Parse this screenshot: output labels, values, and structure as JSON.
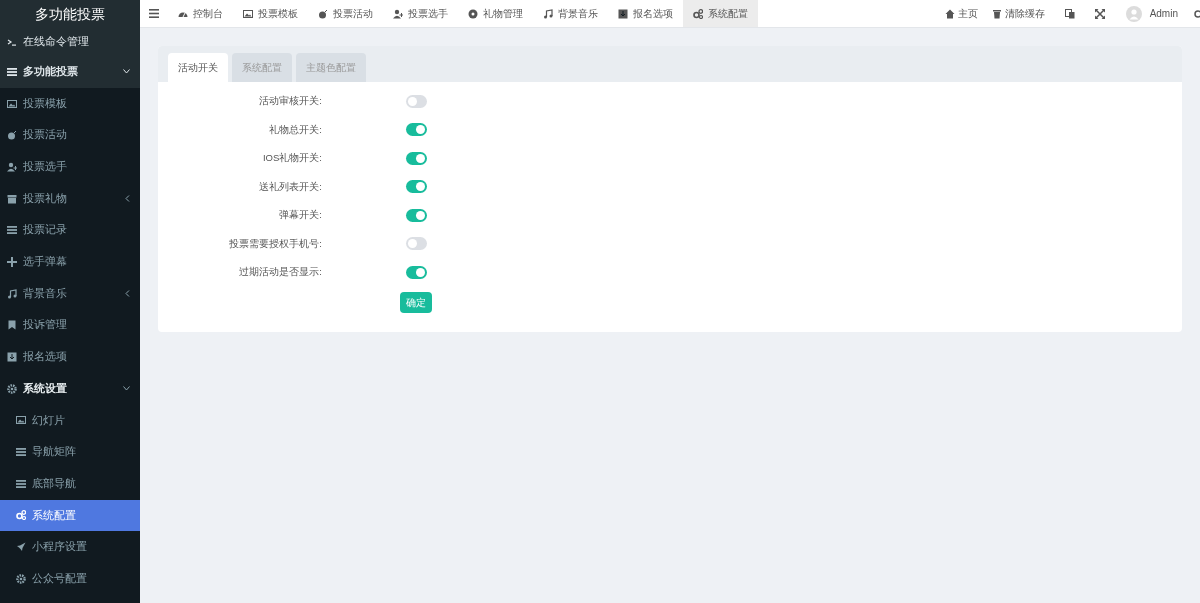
{
  "logo": "多功能投票",
  "sidebar": {
    "items": [
      {
        "label": "在线命令管理",
        "kind": "item",
        "selected": false
      },
      {
        "label": "多功能投票",
        "kind": "group",
        "expanded": true,
        "children": [
          {
            "label": "投票模板",
            "kind": "item",
            "selected": false
          },
          {
            "label": "投票活动",
            "kind": "item",
            "selected": false
          },
          {
            "label": "投票选手",
            "kind": "item",
            "selected": false
          },
          {
            "label": "投票礼物",
            "kind": "group",
            "expanded": false
          },
          {
            "label": "投票记录",
            "kind": "item",
            "selected": false
          },
          {
            "label": "选手弹幕",
            "kind": "item",
            "selected": false
          },
          {
            "label": "背景音乐",
            "kind": "group",
            "expanded": false
          },
          {
            "label": "投诉管理",
            "kind": "item",
            "selected": false
          },
          {
            "label": "报名选项",
            "kind": "item",
            "selected": false
          },
          {
            "label": "系统设置",
            "kind": "group",
            "expanded": true,
            "children": [
              {
                "label": "幻灯片",
                "kind": "item",
                "selected": false
              },
              {
                "label": "导航矩阵",
                "kind": "item",
                "selected": false
              },
              {
                "label": "底部导航",
                "kind": "item",
                "selected": false
              },
              {
                "label": "系统配置",
                "kind": "item",
                "selected": true
              },
              {
                "label": "小程序设置",
                "kind": "item",
                "selected": false
              },
              {
                "label": "公众号配置",
                "kind": "item",
                "selected": false
              }
            ]
          }
        ]
      }
    ]
  },
  "topnav": {
    "tabs": [
      {
        "label": "控制台",
        "selected": false
      },
      {
        "label": "投票模板",
        "selected": false
      },
      {
        "label": "投票活动",
        "selected": false
      },
      {
        "label": "投票选手",
        "selected": false
      },
      {
        "label": "礼物管理",
        "selected": false
      },
      {
        "label": "背景音乐",
        "selected": false
      },
      {
        "label": "报名选项",
        "selected": false
      },
      {
        "label": "系统配置",
        "selected": true
      }
    ],
    "right": {
      "home": "主页",
      "clear_cache": "清除缓存",
      "user": "Admin"
    }
  },
  "panel": {
    "tabs": [
      {
        "label": "活动开关",
        "selected": true
      },
      {
        "label": "系统配置",
        "selected": false
      },
      {
        "label": "主题色配置",
        "selected": false
      }
    ],
    "switches": [
      {
        "label": "活动审核开关:",
        "on": false
      },
      {
        "label": "礼物总开关:",
        "on": true
      },
      {
        "label": "IOS礼物开关:",
        "on": true
      },
      {
        "label": "送礼列表开关:",
        "on": true
      },
      {
        "label": "弹幕开关:",
        "on": true
      },
      {
        "label": "投票需要授权手机号:",
        "on": false
      },
      {
        "label": "过期活动是否显示:",
        "on": true
      }
    ],
    "submit": "确定"
  }
}
